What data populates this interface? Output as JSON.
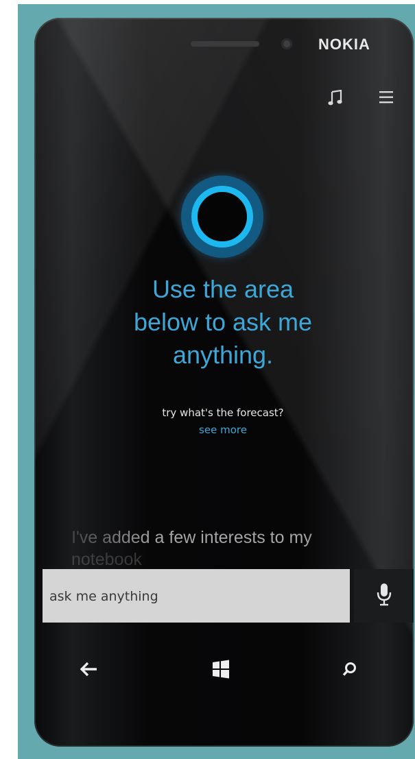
{
  "device": {
    "brand": "NOKIA"
  },
  "cortana": {
    "prompt_lines": [
      "Use the area",
      "below to ask me",
      "anything."
    ],
    "suggestion": "try what's the forecast?",
    "see_more": "see more",
    "interest_line1": "I've added a few interests to my",
    "interest_line2": "notebook"
  },
  "search": {
    "placeholder": "ask me anything"
  },
  "icons": {
    "music": "music-note-icon",
    "menu": "hamburger-menu-icon",
    "mic": "microphone-icon",
    "back": "back-arrow-icon",
    "start": "windows-logo-icon",
    "search": "search-icon"
  },
  "colors": {
    "accent": "#3ea7d8",
    "cortana_ring": "#1eb8f0",
    "frame": "#63a9ae",
    "search_bar": "#d5d5d5"
  }
}
